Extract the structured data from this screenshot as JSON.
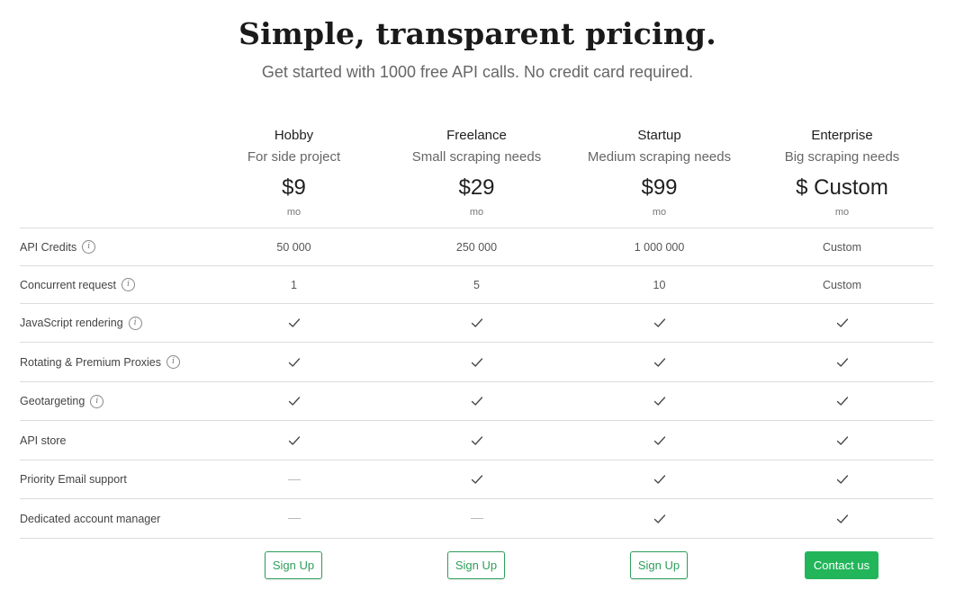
{
  "header": {
    "title": "Simple, transparent pricing.",
    "subtitle": "Get started with 1000 free API calls. No credit card required."
  },
  "plans": [
    {
      "name": "Hobby",
      "description": "For side project",
      "price": "$9",
      "period": "mo",
      "cta": "Sign Up"
    },
    {
      "name": "Freelance",
      "description": "Small scraping needs",
      "price": "$29",
      "period": "mo",
      "cta": "Sign Up"
    },
    {
      "name": "Startup",
      "description": "Medium scraping needs",
      "price": "$99",
      "period": "mo",
      "cta": "Sign Up"
    },
    {
      "name": "Enterprise",
      "description": "Big scraping needs",
      "price": "$ Custom",
      "period": "mo",
      "cta": "Contact us"
    }
  ],
  "features": [
    {
      "label": "API Credits",
      "info": true,
      "values": [
        "50 000",
        "250 000",
        "1 000 000",
        "Custom"
      ]
    },
    {
      "label": "Concurrent request",
      "info": true,
      "values": [
        "1",
        "5",
        "10",
        "Custom"
      ]
    },
    {
      "label": "JavaScript rendering",
      "info": true,
      "values": [
        "check",
        "check",
        "check",
        "check"
      ]
    },
    {
      "label": "Rotating & Premium Proxies",
      "info": true,
      "values": [
        "check",
        "check",
        "check",
        "check"
      ]
    },
    {
      "label": "Geotargeting",
      "info": true,
      "values": [
        "check",
        "check",
        "check",
        "check"
      ]
    },
    {
      "label": "API store",
      "info": false,
      "values": [
        "check",
        "check",
        "check",
        "check"
      ]
    },
    {
      "label": "Priority Email support",
      "info": false,
      "values": [
        "dash",
        "check",
        "check",
        "check"
      ]
    },
    {
      "label": "Dedicated account manager",
      "info": false,
      "values": [
        "dash",
        "dash",
        "check",
        "check"
      ]
    }
  ],
  "colors": {
    "accent": "#23b55a",
    "accent_outline": "#2e9e5b",
    "border": "#dcdcdc"
  },
  "icons": {
    "info": "info-circle-icon",
    "included": "check-icon",
    "not_included": "dash-icon"
  }
}
